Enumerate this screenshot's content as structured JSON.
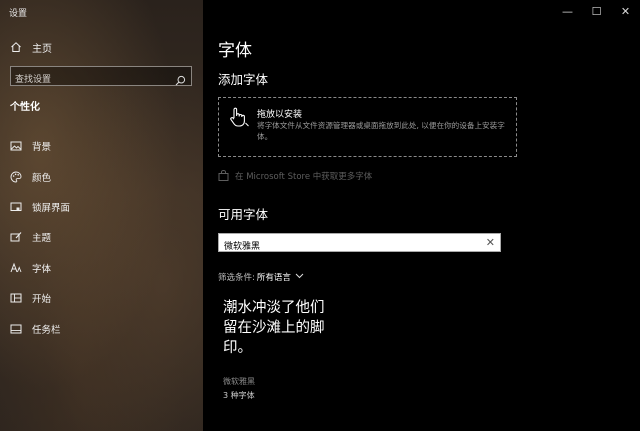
{
  "window": {
    "app_title": "设置",
    "controls": {
      "minimize": "—",
      "maximize": "☐",
      "close": "✕"
    }
  },
  "sidebar": {
    "home_label": "主页",
    "search_placeholder": "查找设置",
    "section_title": "个性化",
    "items": [
      {
        "label": "背景",
        "icon": "image-icon"
      },
      {
        "label": "颜色",
        "icon": "palette-icon"
      },
      {
        "label": "锁屏界面",
        "icon": "lock-screen-icon"
      },
      {
        "label": "主题",
        "icon": "brush-icon"
      },
      {
        "label": "字体",
        "icon": "font-icon"
      },
      {
        "label": "开始",
        "icon": "start-icon"
      },
      {
        "label": "任务栏",
        "icon": "taskbar-icon"
      }
    ]
  },
  "main": {
    "title": "字体",
    "add_section_title": "添加字体",
    "dropzone": {
      "title": "拖放以安装",
      "description": "将字体文件从文件资源管理器或桌面拖放到此处, 以便在你的设备上安装字体。"
    },
    "store_link": "在 Microsoft Store 中获取更多字体",
    "available_title": "可用字体",
    "font_search_value": "微软雅黑",
    "filter_label": "筛选条件:",
    "filter_value": "所有语言",
    "font_card": {
      "preview": "潮水冲淡了他们留在沙滩上的脚印。",
      "name": "微软雅黑",
      "count": "3 种字体"
    }
  },
  "colors": {
    "sidebar_bg": "#3a2e24",
    "main_bg": "#000000",
    "text": "#ffffff",
    "muted": "#8a8a8a",
    "disabled_link": "#5e5e5e"
  }
}
